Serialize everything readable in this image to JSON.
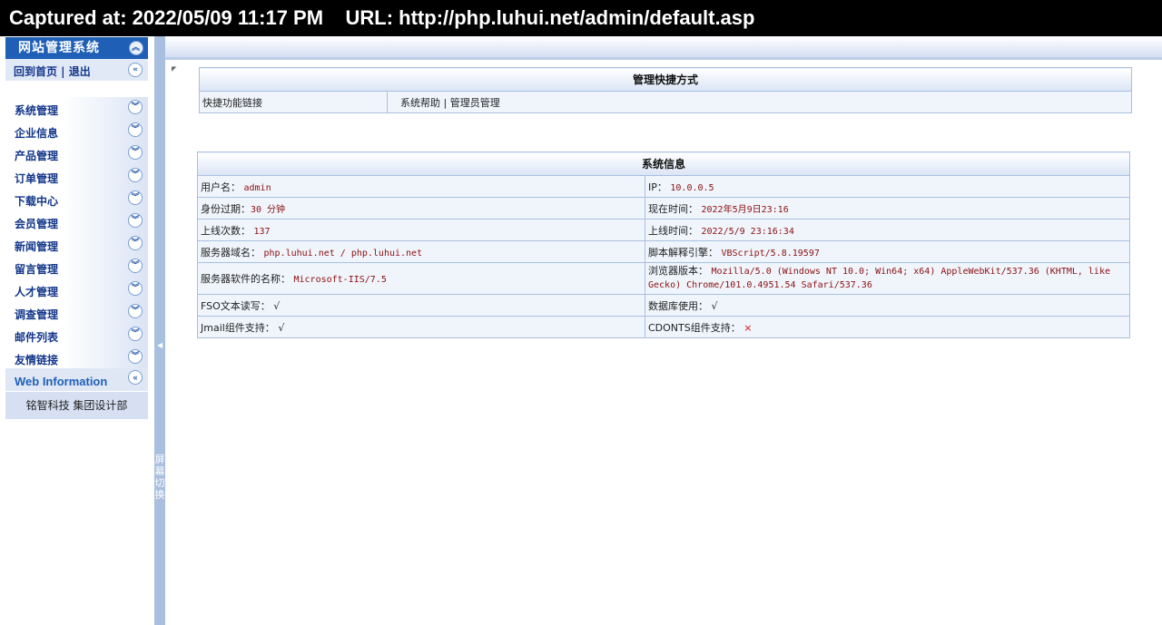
{
  "capture": {
    "text": "Captured at: 2022/05/09 11:17 PM    URL: http://php.luhui.net/admin/default.asp"
  },
  "sidebar": {
    "title": "网站管理系统",
    "home_links": "回到首页 | 退出",
    "items": [
      {
        "label": "系统管理"
      },
      {
        "label": "企业信息"
      },
      {
        "label": "产品管理"
      },
      {
        "label": "订单管理"
      },
      {
        "label": "下载中心"
      },
      {
        "label": "会员管理"
      },
      {
        "label": "新闻管理"
      },
      {
        "label": "留言管理"
      },
      {
        "label": "人才管理"
      },
      {
        "label": "调查管理"
      },
      {
        "label": "邮件列表"
      },
      {
        "label": "友情链接"
      }
    ],
    "web_info_label": "Web Information",
    "company": "铭智科技 集团设计部"
  },
  "splitter": {
    "label": "屏幕切换"
  },
  "shortcuts": {
    "title": "管理快捷方式",
    "label": "快捷功能链接",
    "links": "系统帮助 | 管理员管理"
  },
  "sysinfo": {
    "title": "系统信息",
    "rows": [
      {
        "l_label": "用户名：",
        "l_value": "admin",
        "r_label": "IP：",
        "r_value": "10.0.0.5"
      },
      {
        "l_label": "身份过期：",
        "l_value": "30 分钟",
        "r_label": "现在时间：",
        "r_value": "2022年5月9日23:16"
      },
      {
        "l_label": "上线次数：",
        "l_value": "137",
        "r_label": "上线时间：",
        "r_value": "2022/5/9 23:16:34"
      },
      {
        "l_label": "服务器域名：",
        "l_value": "php.luhui.net / php.luhui.net",
        "r_label": "脚本解释引擎：",
        "r_value": "VBScript/5.8.19597"
      },
      {
        "l_label": "服务器软件的名称：",
        "l_value": "Microsoft-IIS/7.5",
        "r_label": "浏览器版本：",
        "r_value": "Mozilla/5.0 (Windows NT 10.0; Win64; x64) AppleWebKit/537.36 (KHTML, like Gecko) Chrome/101.0.4951.54 Safari/537.36"
      },
      {
        "l_label": "FSO文本读写：",
        "l_value": "√",
        "r_label": "数据库使用：",
        "r_value": "√"
      },
      {
        "l_label": "Jmail组件支持：",
        "l_value": "√",
        "r_label": "CDONTS组件支持：",
        "r_value": "×"
      }
    ]
  }
}
